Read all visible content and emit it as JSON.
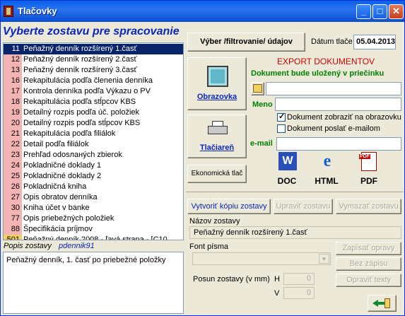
{
  "window": {
    "title": "Tlačovky"
  },
  "heading": "Vyberte zostavu pre spracovanie",
  "reports": [
    {
      "num": "11",
      "label": "Peňažný denník rozšírený 1.časť",
      "selected": true
    },
    {
      "num": "12",
      "label": "Peňažný denník rozšírený 2.časť"
    },
    {
      "num": "13",
      "label": "Peňažný denník rozšírený 3.časť"
    },
    {
      "num": "16",
      "label": "Rekapitulácia podľa členenia denníka"
    },
    {
      "num": "17",
      "label": "Kontrola denníka podľa Výkazu o PV"
    },
    {
      "num": "18",
      "label": "Rekapitulácia podľa stĺpcov KBS"
    },
    {
      "num": "19",
      "label": "Detailný rozpis podľa úč. položiek"
    },
    {
      "num": "20",
      "label": "Detailný rozpis podľa stĺpcov KBS"
    },
    {
      "num": "21",
      "label": "Rekapitulácia podľa filiálok"
    },
    {
      "num": "22",
      "label": "Detail podľa filiálok"
    },
    {
      "num": "23",
      "label": "Prehľad odosланých zbierok"
    },
    {
      "num": "24",
      "label": "Pokladničné doklady 1"
    },
    {
      "num": "25",
      "label": "Pokladničné doklady 2"
    },
    {
      "num": "26",
      "label": "Pokladničná kniha"
    },
    {
      "num": "27",
      "label": "Opis obratov denníka"
    },
    {
      "num": "30",
      "label": "Kniha účet v banke"
    },
    {
      "num": "77",
      "label": "Opis priebežných položiek"
    },
    {
      "num": "88",
      "label": "Špecifikácia príjmov"
    },
    {
      "num": "501",
      "label": "Peňažný denník 2008 - ľavá strana - [C10"
    }
  ],
  "popis": {
    "label": "Popis zostavy",
    "value": "pdennik91"
  },
  "description": "Peňažný denník, 1. časť po priebežné položky",
  "toolbar": {
    "filter_button": "Výber /filtrovanie/ údajov",
    "date_label": "Dátum tlače",
    "date_value": "05.04.2013"
  },
  "export": {
    "title": "EXPORT DOKUMENTOV",
    "saved_in": "Dokument bude uložený v priečinku",
    "name_label": "Meno",
    "show_label": "Dokument zobraziť na obrazovku",
    "show_checked": true,
    "email_send_label": "Dokument poslať e-mailom",
    "email_send_checked": false,
    "email_label": "e-mail",
    "doc_label": "DOC",
    "html_label": "HTML",
    "pdf_label": "PDF"
  },
  "output": {
    "screen_label": "Obrazovka",
    "printer_label": "Tlačiareň",
    "eco_label": "Ekonomická tlač"
  },
  "edit": {
    "copy_button": "Vytvoriť kópiu zostavy",
    "modify_button": "Upraviť zostavu",
    "delete_button": "Vymazať zostavu",
    "name_label": "Názov zostavy",
    "name_value": "Peňažný denník rozšírený 1.časť",
    "font_label": "Font písma",
    "save_button": "Zapísať opravy",
    "nosave_button": "Bez zápisu",
    "fix_text_button": "Opraviť texty",
    "offset_label": "Posun zostavy (v mm)",
    "h_label": "H",
    "h_value": "0",
    "v_label": "V",
    "v_value": "0"
  },
  "colors": {
    "accent": "#0b26b7",
    "selection": "#0a246a",
    "export_title": "#d00000",
    "green": "#008000",
    "row_num": "#f4b4b4"
  }
}
